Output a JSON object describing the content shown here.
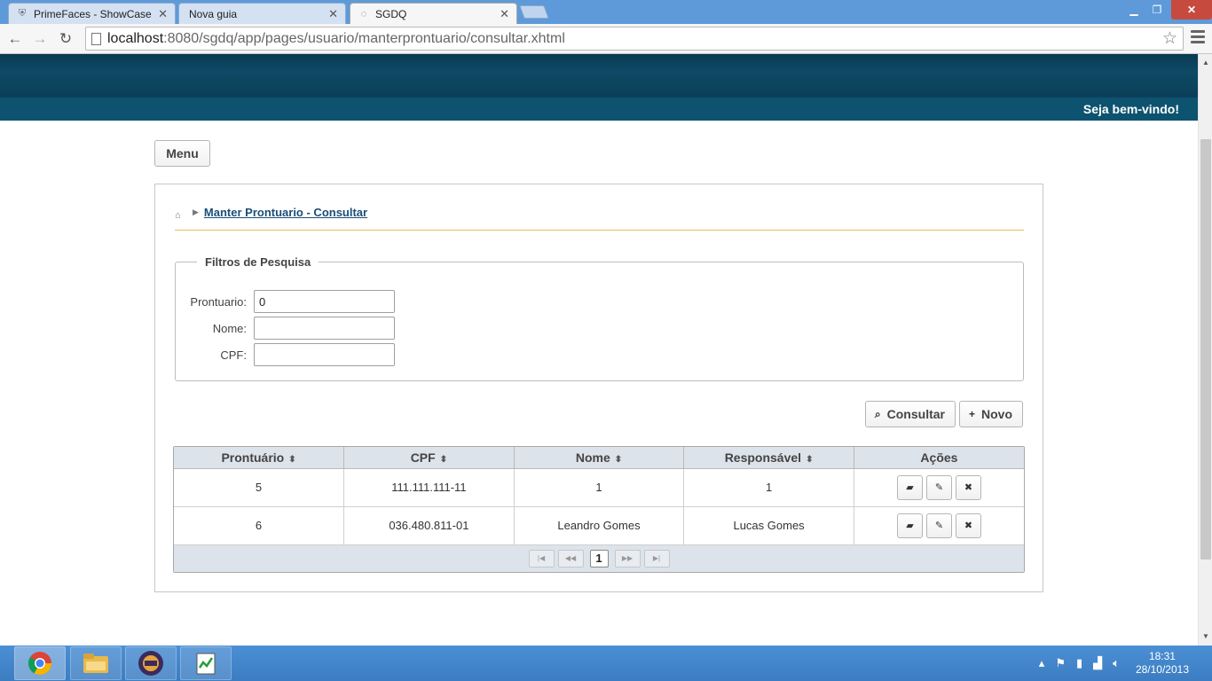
{
  "browser": {
    "tabs": [
      {
        "title": "PrimeFaces - ShowCase",
        "active": false
      },
      {
        "title": "Nova guia",
        "active": false
      },
      {
        "title": "SGDQ",
        "active": true
      }
    ],
    "url_host": "localhost",
    "url_path": ":8080/sgdq/app/pages/usuario/manterprontuario/consultar.xhtml",
    "window_controls": {
      "minimize": "▁",
      "restore": "❐",
      "close": "✕"
    }
  },
  "header": {
    "welcome": "Seja bem-vindo!"
  },
  "menu_button": "Menu",
  "breadcrumb": {
    "current": "Manter Prontuario - Consultar"
  },
  "filters": {
    "legend": "Filtros de Pesquisa",
    "prontuario_label": "Prontuario:",
    "prontuario_value": "0",
    "nome_label": "Nome:",
    "nome_value": "",
    "cpf_label": "CPF:",
    "cpf_value": ""
  },
  "buttons": {
    "consultar": "Consultar",
    "novo": "Novo"
  },
  "table": {
    "headers": [
      "Prontuário",
      "CPF",
      "Nome",
      "Responsável",
      "Ações"
    ],
    "rows": [
      {
        "prontuario": "5",
        "cpf": "111.111.111-11",
        "nome": "1",
        "responsavel": "1"
      },
      {
        "prontuario": "6",
        "cpf": "036.480.811-01",
        "nome": "Leandro Gomes",
        "responsavel": "Lucas Gomes"
      }
    ],
    "paginator": {
      "current_page": "1"
    }
  },
  "taskbar": {
    "apps": [
      "chrome-icon",
      "file-explorer-icon",
      "java-ee-ide-icon",
      "notepad-icon"
    ],
    "clock_time": "18:31",
    "clock_date": "28/10/2013"
  },
  "colors": {
    "header_dark": "#0b3f58",
    "header_strip": "#0d5370",
    "breadcrumb_underline": "#e2c35a",
    "table_header": "#dde3ea",
    "taskbar": "#3c7dc2"
  }
}
